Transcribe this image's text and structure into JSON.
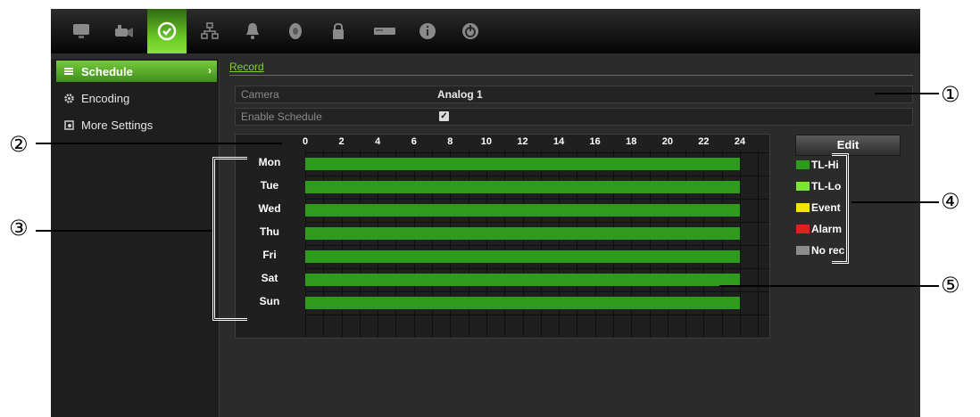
{
  "toolbar": {
    "tabs": [
      {
        "icon": "monitor-icon",
        "active": false
      },
      {
        "icon": "camera-icon",
        "active": false
      },
      {
        "icon": "clock-icon",
        "active": true
      },
      {
        "icon": "network-icon",
        "active": false
      },
      {
        "icon": "bell-icon",
        "active": false
      },
      {
        "icon": "hard-disk-icon",
        "active": false
      },
      {
        "icon": "lock-icon",
        "active": false
      },
      {
        "icon": "device-icon",
        "active": false
      },
      {
        "icon": "info-icon",
        "active": false
      },
      {
        "icon": "power-icon",
        "active": false
      }
    ]
  },
  "sidebar": {
    "items": [
      {
        "label": "Schedule",
        "icon": "list-icon",
        "active": true
      },
      {
        "label": "Encoding",
        "icon": "gear-icon",
        "active": false
      },
      {
        "label": "More Settings",
        "icon": "settings-icon",
        "active": false
      }
    ]
  },
  "main": {
    "tab_label": "Record",
    "camera_label": "Camera",
    "camera_value": "Analog 1",
    "enable_label": "Enable Schedule",
    "enable_checked": true,
    "edit_label": "Edit"
  },
  "schedule": {
    "hour_labels": [
      "0",
      "2",
      "4",
      "6",
      "8",
      "10",
      "12",
      "14",
      "16",
      "18",
      "20",
      "22",
      "24"
    ],
    "days": [
      {
        "label": "Mon",
        "mode": "TL-Hi",
        "start": 0,
        "end": 24
      },
      {
        "label": "Tue",
        "mode": "TL-Hi",
        "start": 0,
        "end": 24
      },
      {
        "label": "Wed",
        "mode": "TL-Hi",
        "start": 0,
        "end": 24
      },
      {
        "label": "Thu",
        "mode": "TL-Hi",
        "start": 0,
        "end": 24
      },
      {
        "label": "Fri",
        "mode": "TL-Hi",
        "start": 0,
        "end": 24
      },
      {
        "label": "Sat",
        "mode": "TL-Hi",
        "start": 0,
        "end": 24
      },
      {
        "label": "Sun",
        "mode": "TL-Hi",
        "start": 0,
        "end": 24
      }
    ]
  },
  "legend": [
    {
      "label": "TL-Hi",
      "color": "#2e9b1c"
    },
    {
      "label": "TL-Lo",
      "color": "#7ee33a"
    },
    {
      "label": "Event",
      "color": "#f2e600"
    },
    {
      "label": "Alarm",
      "color": "#e02020"
    },
    {
      "label": "No rec",
      "color": "#8c8c8c"
    }
  ],
  "callouts": [
    "①",
    "②",
    "③",
    "④",
    "⑤"
  ]
}
